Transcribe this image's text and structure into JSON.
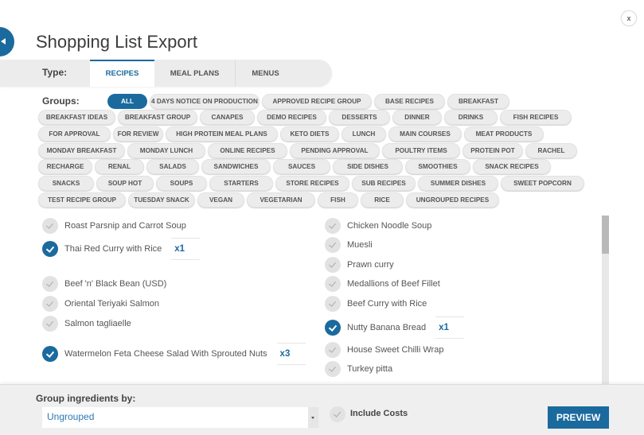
{
  "header": {
    "title": "Shopping List Export",
    "close_label": "x"
  },
  "type": {
    "label": "Type:",
    "tabs": [
      {
        "label": "RECIPES",
        "active": true
      },
      {
        "label": "MEAL PLANS",
        "active": false
      },
      {
        "label": "MENUS",
        "active": false
      }
    ]
  },
  "groups": {
    "label": "Groups:",
    "rows": [
      [
        "ALL",
        "4 DAYS NOTICE ON PRODUCTION",
        "APPROVED RECIPE GROUP",
        "BASE RECIPES",
        "BREAKFAST"
      ],
      [
        "BREAKFAST IDEAS",
        "BREAKFAST GROUP",
        "CANAPES",
        "DEMO RECIPES",
        "DESSERTS",
        "DINNER",
        "DRINKS",
        "FISH RECIPES"
      ],
      [
        "FOR APPROVAL",
        "FOR REVIEW",
        "HIGH PROTEIN MEAL PLANS",
        "KETO DIETS",
        "LUNCH",
        "MAIN COURSES",
        "MEAT PRODUCTS"
      ],
      [
        "MONDAY BREAKFAST",
        "MONDAY LUNCH",
        "ONLINE RECIPES",
        "PENDING APPROVAL",
        "POULTRY ITEMS",
        "PROTEIN POT",
        "RACHEL"
      ],
      [
        "RECHARGE",
        "RENAL",
        "SALADS",
        "SANDWICHES",
        "SAUCES",
        "SIDE DISHES",
        "SMOOTHIES",
        "SNACK RECIPES"
      ],
      [
        "SNACKS",
        "SOUP HOT",
        "SOUPS",
        "STARTERS",
        "STORE RECIPES",
        "SUB RECIPES",
        "SUMMER DISHES",
        "SWEET POPCORN"
      ],
      [
        "TEST RECIPE GROUP",
        "TUESDAY SNACK",
        "VEGAN",
        "VEGETARIAN",
        "FISH",
        "RICE",
        "UNGROUPED RECIPES"
      ]
    ],
    "active": "ALL"
  },
  "recipes": {
    "left": [
      {
        "name": "Roast Parsnip and Carrot Soup",
        "checked": false
      },
      {
        "name": "Thai Red Curry with Rice",
        "checked": true,
        "qty": "x1"
      },
      {
        "name": "Beef 'n' Black Bean (USD)",
        "checked": false
      },
      {
        "name": "Oriental Teriyaki Salmon",
        "checked": false
      },
      {
        "name": "Salmon tagliaelle",
        "checked": false
      },
      {
        "name": "Watermelon Feta Cheese Salad With Sprouted Nuts",
        "checked": true,
        "qty": "x3"
      }
    ],
    "right": [
      {
        "name": "Chicken Noodle Soup",
        "checked": false
      },
      {
        "name": "Muesli",
        "checked": false
      },
      {
        "name": "Prawn curry",
        "checked": false
      },
      {
        "name": "Medallions of Beef Fillet",
        "checked": false
      },
      {
        "name": "Beef Curry with Rice",
        "checked": false
      },
      {
        "name": "Nutty Banana Bread",
        "checked": true,
        "qty": "x1"
      },
      {
        "name": "House Sweet Chilli Wrap",
        "checked": false
      },
      {
        "name": "Turkey pitta",
        "checked": false
      }
    ]
  },
  "footer": {
    "group_label": "Group ingredients by:",
    "group_value": "Ungrouped",
    "include_costs_label": "Include Costs",
    "include_costs_checked": false,
    "preview_label": "PREVIEW"
  },
  "colors": {
    "accent": "#1a6a9e",
    "chip_bg": "#ececec",
    "footer_bg": "#efefef"
  }
}
